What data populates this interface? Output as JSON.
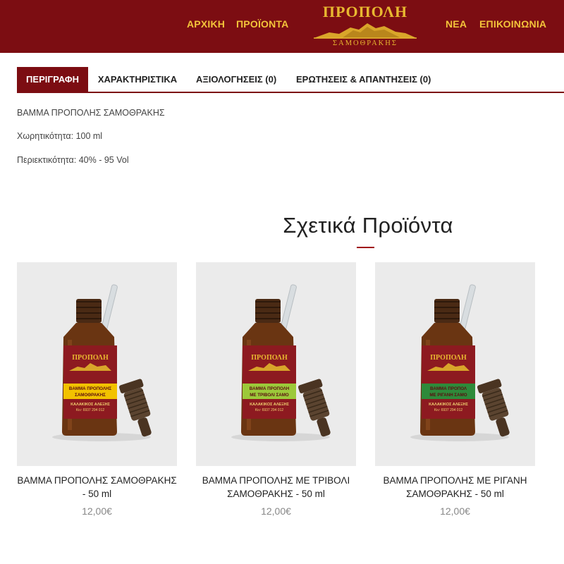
{
  "header": {
    "nav_left": [
      "ΑΡΧΙΚΗ",
      "ΠΡΟΪΟΝΤΑ"
    ],
    "nav_right": [
      "ΝΕΑ",
      "ΕΠΙΚΟΙΝΩΝΙΑ"
    ],
    "logo_title": "ΠΡΟΠΟΛΗ",
    "logo_subtitle": "ΣΑΜΟΘΡΑΚΗΣ",
    "bg_color": "#7c0d12",
    "accent_color": "#f3c43a"
  },
  "tabs": [
    {
      "label": "ΠΕΡΙΓΡΑΦΗ",
      "active": true
    },
    {
      "label": "ΧΑΡΑΚΤΗΡΙΣΤΙΚΑ",
      "active": false
    },
    {
      "label": "ΑΞΙΟΛΟΓΗΣΕΙΣ (0)",
      "active": false
    },
    {
      "label": "ΕΡΩΤΗΣΕΙΣ & ΑΠΑΝΤΗΣΕΙΣ (0)",
      "active": false
    }
  ],
  "description": [
    "ΒΑΜΜΑ ΠΡΟΠΟΛΗΣ ΣΑΜΟΘΡΑΚΗΣ",
    "Χωρητικότητα: 100 ml",
    "Περιεκτικότητα: 40% - 95 Vol"
  ],
  "related": {
    "title": "Σχετικά Προϊόντα",
    "products": [
      {
        "name": "ΒΑΜΜΑ ΠΡΟΠΟΛΗΣ ΣΑΜΟΘΡΑΚΗΣ - 50 ml",
        "price": "12,00€",
        "label_color": "#f2c200",
        "label_lines": [
          "ΒΑΜΜΑ ΠΡΟΠΟΛΗΣ",
          "ΣΑΜΟΘΡΑΚΗΣ"
        ]
      },
      {
        "name": "ΒΑΜΜΑ ΠΡΟΠΟΛΗΣ ΜΕ ΤΡΙΒΟΛΙ ΣΑΜΟΘΡΑΚΗΣ - 50 ml",
        "price": "12,00€",
        "label_color": "#9cc93a",
        "label_lines": [
          "ΒΑΜΜΑ ΠΡΟΠΟΛΗ",
          "ΜΕ ΤΡΙΒΟΛΙ ΣΑΜΟ"
        ]
      },
      {
        "name": "ΒΑΜΜΑ ΠΡΟΠΟΛΗΣ ΜΕ ΡΙΓΑΝΗ ΣΑΜΟΘΡΑΚΗΣ - 50 ml",
        "price": "12,00€",
        "label_color": "#2e8a3a",
        "label_lines": [
          "ΒΑΜΜΑ ΠΡΟΠΟΛ",
          "ΜΕ ΡΙΓΑΝΗ ΣΑΜΟ"
        ]
      }
    ],
    "bottle_brand": "ΠΡΟΠΟΛΗ",
    "bottle_maker": "ΚΑΛΑΚΙΚΟΣ ΑΛΕΞΗΣ",
    "bottle_phone": "Κιν: 6937 294 012"
  }
}
